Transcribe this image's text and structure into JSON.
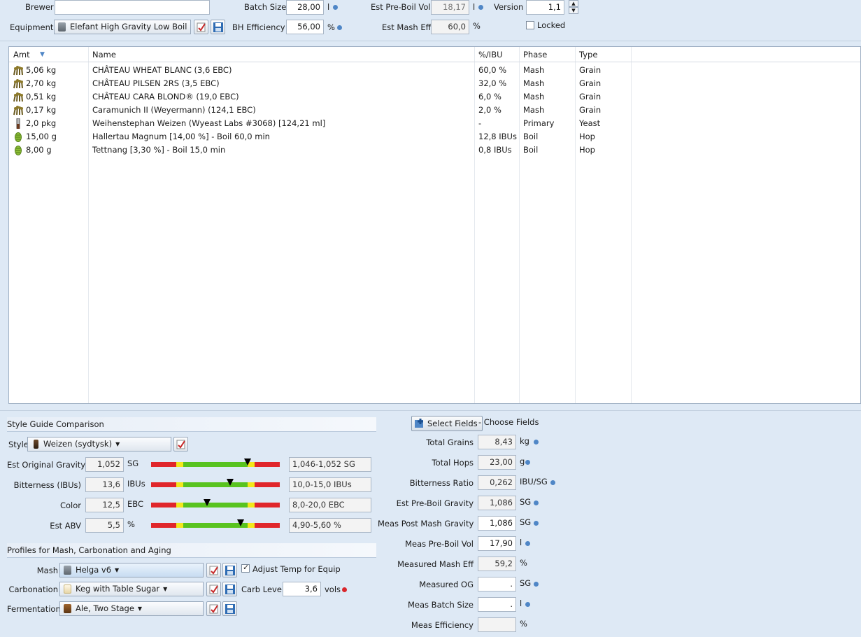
{
  "recipe": {
    "brewer_label": "Brewer",
    "brewer_value": "",
    "equipment_label": "Equipment",
    "equipment_value": "Elefant High Gravity Low Boil",
    "batch_size_label": "Batch Size",
    "batch_size_value": "28,00",
    "batch_size_unit": "l",
    "bh_efficiency_label": "BH Efficiency",
    "bh_efficiency_value": "56,00",
    "bh_efficiency_unit": "%",
    "pre_boil_label": "Est Pre-Boil Vol",
    "pre_boil_value": "18,17",
    "pre_boil_unit": "l",
    "mash_eff_label": "Est Mash Eff",
    "mash_eff_value": "60,0",
    "mash_eff_unit": "%",
    "version_label": "Version",
    "version_value": "1,1",
    "locked_label": "Locked",
    "locked_checked": false
  },
  "ingredients": {
    "columns": [
      "Amt",
      "Name",
      "%/IBU",
      "Phase",
      "Type"
    ],
    "rows": [
      {
        "icon": "grain",
        "amt": "5,06 kg",
        "name": "CHÂTEAU WHEAT BLANC (3,6 EBC)",
        "pct": "60,0 %",
        "phase": "Mash",
        "type": "Grain"
      },
      {
        "icon": "grain",
        "amt": "2,70 kg",
        "name": "CHÂTEAU PILSEN 2RS (3,5 EBC)",
        "pct": "32,0 %",
        "phase": "Mash",
        "type": "Grain"
      },
      {
        "icon": "grain",
        "amt": "0,51 kg",
        "name": "CHÂTEAU CARA BLOND® (19,0 EBC)",
        "pct": "6,0 %",
        "phase": "Mash",
        "type": "Grain"
      },
      {
        "icon": "grain",
        "amt": "0,17 kg",
        "name": "Caramunich II (Weyermann) (124,1 EBC)",
        "pct": "2,0 %",
        "phase": "Mash",
        "type": "Grain"
      },
      {
        "icon": "yeast",
        "amt": "2,0 pkg",
        "name": "Weihenstephan Weizen (Wyeast Labs #3068) [124,21 ml]",
        "pct": "-",
        "phase": "Primary",
        "type": "Yeast"
      },
      {
        "icon": "hop",
        "amt": "15,00 g",
        "name": "Hallertau Magnum [14,00 %] - Boil 60,0 min",
        "pct": "12,8 IBUs",
        "phase": "Boil",
        "type": "Hop"
      },
      {
        "icon": "hop",
        "amt": "8,00 g",
        "name": "Tettnang [3,30 %] - Boil 15,0 min",
        "pct": "0,8 IBUs",
        "phase": "Boil",
        "type": "Hop"
      }
    ]
  },
  "style_guide": {
    "section_title": "Style Guide Comparison",
    "style_label": "Style",
    "style_value": "Weizen (sydtysk)",
    "rows": [
      {
        "label": "Est Original Gravity",
        "value": "1,052",
        "unit": "SG",
        "range": "1,046-1,052 SG",
        "marker": 0.75
      },
      {
        "label": "Bitterness (IBUs)",
        "value": "13,6",
        "unit": "IBUs",
        "range": "10,0-15,0 IBUs",
        "marker": 0.615
      },
      {
        "label": "Color",
        "value": "12,5",
        "unit": "EBC",
        "range": "8,0-20,0 EBC",
        "marker": 0.435
      },
      {
        "label": "Est ABV",
        "value": "5,5",
        "unit": "%",
        "range": "4,90-5,60 %",
        "marker": 0.695
      }
    ]
  },
  "profiles": {
    "section_title": "Profiles for Mash, Carbonation and Aging",
    "mash_label": "Mash",
    "mash_value": "Helga v6",
    "adjust_temp_label": "Adjust Temp for Equip",
    "adjust_temp_checked": true,
    "carbonation_label": "Carbonation",
    "carbonation_value": "Keg with Table Sugar",
    "carb_level_label": "Carb Level",
    "carb_level_value": "3,6",
    "carb_level_unit": "vols",
    "fermentation_label": "Fermentation",
    "fermentation_value": "Ale, Two Stage"
  },
  "stats": {
    "select_fields_label": "Select Fields",
    "choose_fields_label": "- Choose Fields",
    "rows": [
      {
        "label": "Total Grains",
        "value": "8,43",
        "unit": "kg",
        "dot": "blue",
        "editable": false
      },
      {
        "label": "Total Hops",
        "value": "23,00",
        "unit": "g",
        "dot": "blue",
        "editable": false
      },
      {
        "label": "Bitterness Ratio",
        "value": "0,262",
        "unit": "IBU/SG",
        "dot": "blue",
        "editable": false
      },
      {
        "label": "Est Pre-Boil Gravity",
        "value": "1,086",
        "unit": "SG",
        "dot": "blue",
        "editable": false
      },
      {
        "label": "Meas Post Mash Gravity",
        "value": "1,086",
        "unit": "SG",
        "dot": "blue",
        "editable": true
      },
      {
        "label": "Meas Pre-Boil Vol",
        "value": "17,90",
        "unit": "l",
        "dot": "blue",
        "editable": true
      },
      {
        "label": "Measured Mash Eff",
        "value": "59,2",
        "unit": "%",
        "dot": "none",
        "editable": false
      },
      {
        "label": "Measured OG",
        "value": ".",
        "unit": "SG",
        "dot": "blue",
        "editable": true
      },
      {
        "label": "Meas Batch Size",
        "value": ".",
        "unit": "l",
        "dot": "blue",
        "editable": true
      },
      {
        "label": "Meas Efficiency",
        "value": "",
        "unit": "%",
        "dot": "none",
        "editable": false
      }
    ]
  },
  "colors": {
    "background": "#dee9f5",
    "accent_dot": "#4f86c6",
    "warn_dot": "#d9262b",
    "bar_red": "#e0262b",
    "bar_yellow": "#f2e81b",
    "bar_green": "#58c31f"
  }
}
